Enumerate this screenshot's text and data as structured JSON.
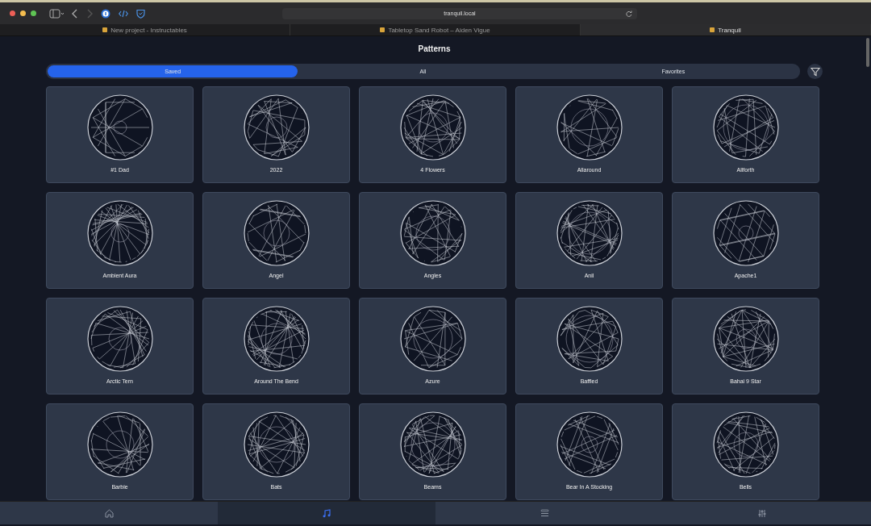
{
  "browser": {
    "url": "tranquil.local",
    "tabs": [
      {
        "title": "New project - Instructables",
        "selected": false
      },
      {
        "title": "Tabletop Sand Robot – Aiden Vigue",
        "selected": false
      },
      {
        "title": "Tranquil",
        "selected": true
      }
    ]
  },
  "page": {
    "title": "Patterns"
  },
  "filter_tabs": [
    {
      "label": "Saved",
      "selected": true
    },
    {
      "label": "All",
      "selected": false
    },
    {
      "label": "Favorites",
      "selected": false
    }
  ],
  "patterns": [
    {
      "name": "#1 Dad"
    },
    {
      "name": "2022"
    },
    {
      "name": "4 Flowers"
    },
    {
      "name": "Allaround"
    },
    {
      "name": "Allforth"
    },
    {
      "name": "Ambient Aura"
    },
    {
      "name": "Angel"
    },
    {
      "name": "Angles"
    },
    {
      "name": "Anil"
    },
    {
      "name": "Apache1"
    },
    {
      "name": "Arctic Tern"
    },
    {
      "name": "Around The Bend"
    },
    {
      "name": "Azure"
    },
    {
      "name": "Baffled"
    },
    {
      "name": "Bahai 9 Star"
    },
    {
      "name": "Barbie"
    },
    {
      "name": "Bats"
    },
    {
      "name": "Beams"
    },
    {
      "name": "Bear In A Stocking"
    },
    {
      "name": "Bells"
    }
  ],
  "bottom_nav": [
    {
      "kind": "home",
      "selected": false
    },
    {
      "kind": "music",
      "selected": true
    },
    {
      "kind": "queue",
      "selected": false
    },
    {
      "kind": "settings",
      "selected": false
    }
  ]
}
